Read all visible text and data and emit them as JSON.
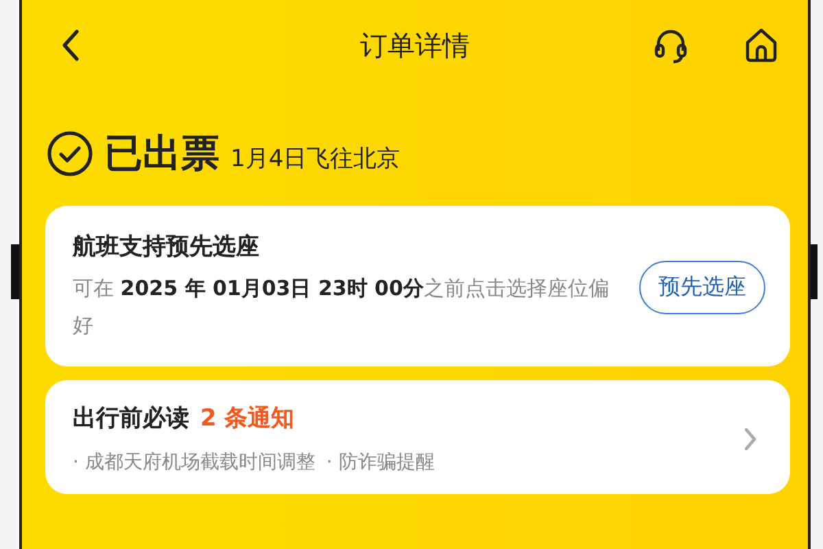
{
  "header": {
    "title": "订单详情"
  },
  "status": {
    "label": "已出票",
    "detail": "1月4日飞往北京"
  },
  "seat_card": {
    "title": "航班支持预先选座",
    "description": "可在 **2025 年 01月03日 23时 00分**之前点击选择座位偏好",
    "button": "预先选座"
  },
  "notice_card": {
    "title": "出行前必读",
    "count": "2 条通知",
    "items": [
      "· 成都天府机场截载时间调整",
      "· 防诈骗提醒"
    ]
  }
}
